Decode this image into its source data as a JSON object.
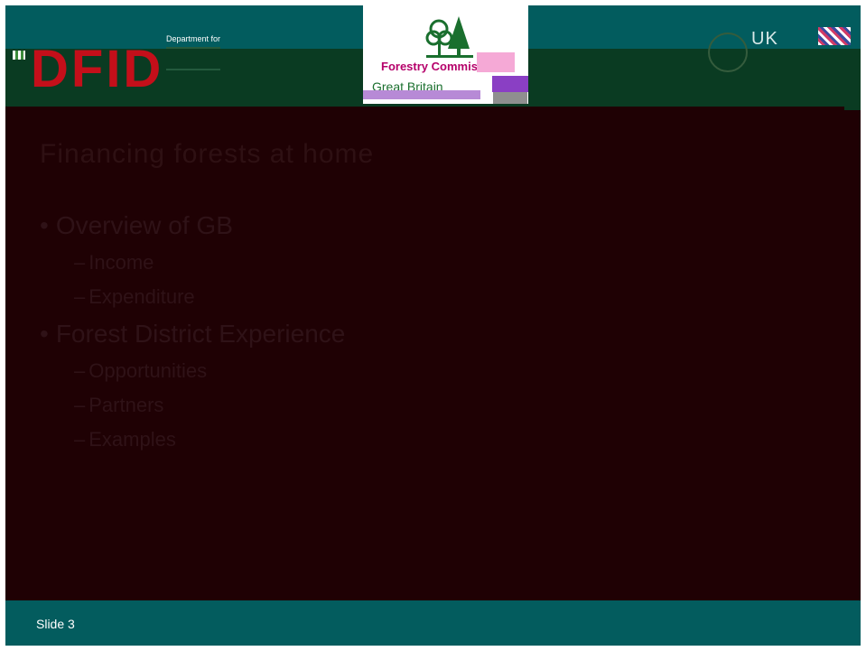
{
  "header": {
    "dfid_logo": {
      "letters": "DFID",
      "department": "Department for"
    },
    "fc_logo": {
      "name": "Forestry Commis",
      "sub": "Great Britain"
    },
    "ukaid_logo": {
      "text": "UK"
    }
  },
  "slide": {
    "title": "Financing forests at home",
    "bullets": [
      {
        "label": "Overview of GB",
        "subitems": [
          "Income",
          "Expenditure"
        ]
      },
      {
        "label": "Forest District Experience",
        "subitems": [
          "Opportunities",
          "Partners",
          "Examples"
        ]
      }
    ],
    "bullet_symbol": "•",
    "sub_symbol": "–"
  },
  "footer": {
    "slide_number": "Slide 3"
  },
  "colors": {
    "slide_background": "#1f0104",
    "bar_teal": "#025c5e",
    "band_green": "#0a3b22",
    "text_dark": "#2f1217",
    "dfid_red": "#c40f1a",
    "fc_magenta": "#b5006a",
    "fc_green": "#1a6f2e"
  }
}
